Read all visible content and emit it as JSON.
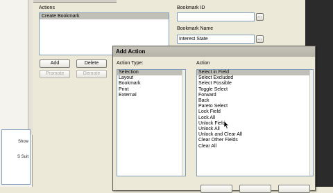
{
  "actions_label": "Actions",
  "actions_list": [
    "Create Bookmark"
  ],
  "buttons": {
    "add": "Add",
    "delete": "Delete",
    "promote": "Promote",
    "demote": "Demote"
  },
  "bookmark_id_label": "Bookmark ID",
  "bookmark_id_value": "",
  "bookmark_name_label": "Bookmark Name",
  "bookmark_name_value": "Interest State",
  "dots_label": "...",
  "left_panel_rows": [
    "Show",
    "S Suit"
  ],
  "dialog": {
    "title": "Add Action",
    "action_type_label": "Action Type:",
    "action_label": "Action",
    "action_types": [
      "Selection",
      "Layout",
      "Bookmark",
      "Print",
      "External"
    ],
    "selected_action_type": "Selection",
    "actions": [
      "Select in Field",
      "Select Excluded",
      "Select Possible",
      "Toggle Select",
      "Forward",
      "Back",
      "Pareto Select",
      "Lock Field",
      "Lock All",
      "Unlock Field",
      "Unlock All",
      "Unlock and Clear All",
      "Clear Other Fields",
      "Clear All"
    ],
    "selected_action": "Select in Field"
  },
  "colors": {
    "selection": "#c0bfb8",
    "window": "#ece9d8",
    "border": "#7f9db9"
  },
  "icons": {
    "cursor": "mouse-pointer-icon",
    "scroll_up": "scroll-up-arrow-icon",
    "scroll_down": "scroll-down-arrow-icon"
  }
}
